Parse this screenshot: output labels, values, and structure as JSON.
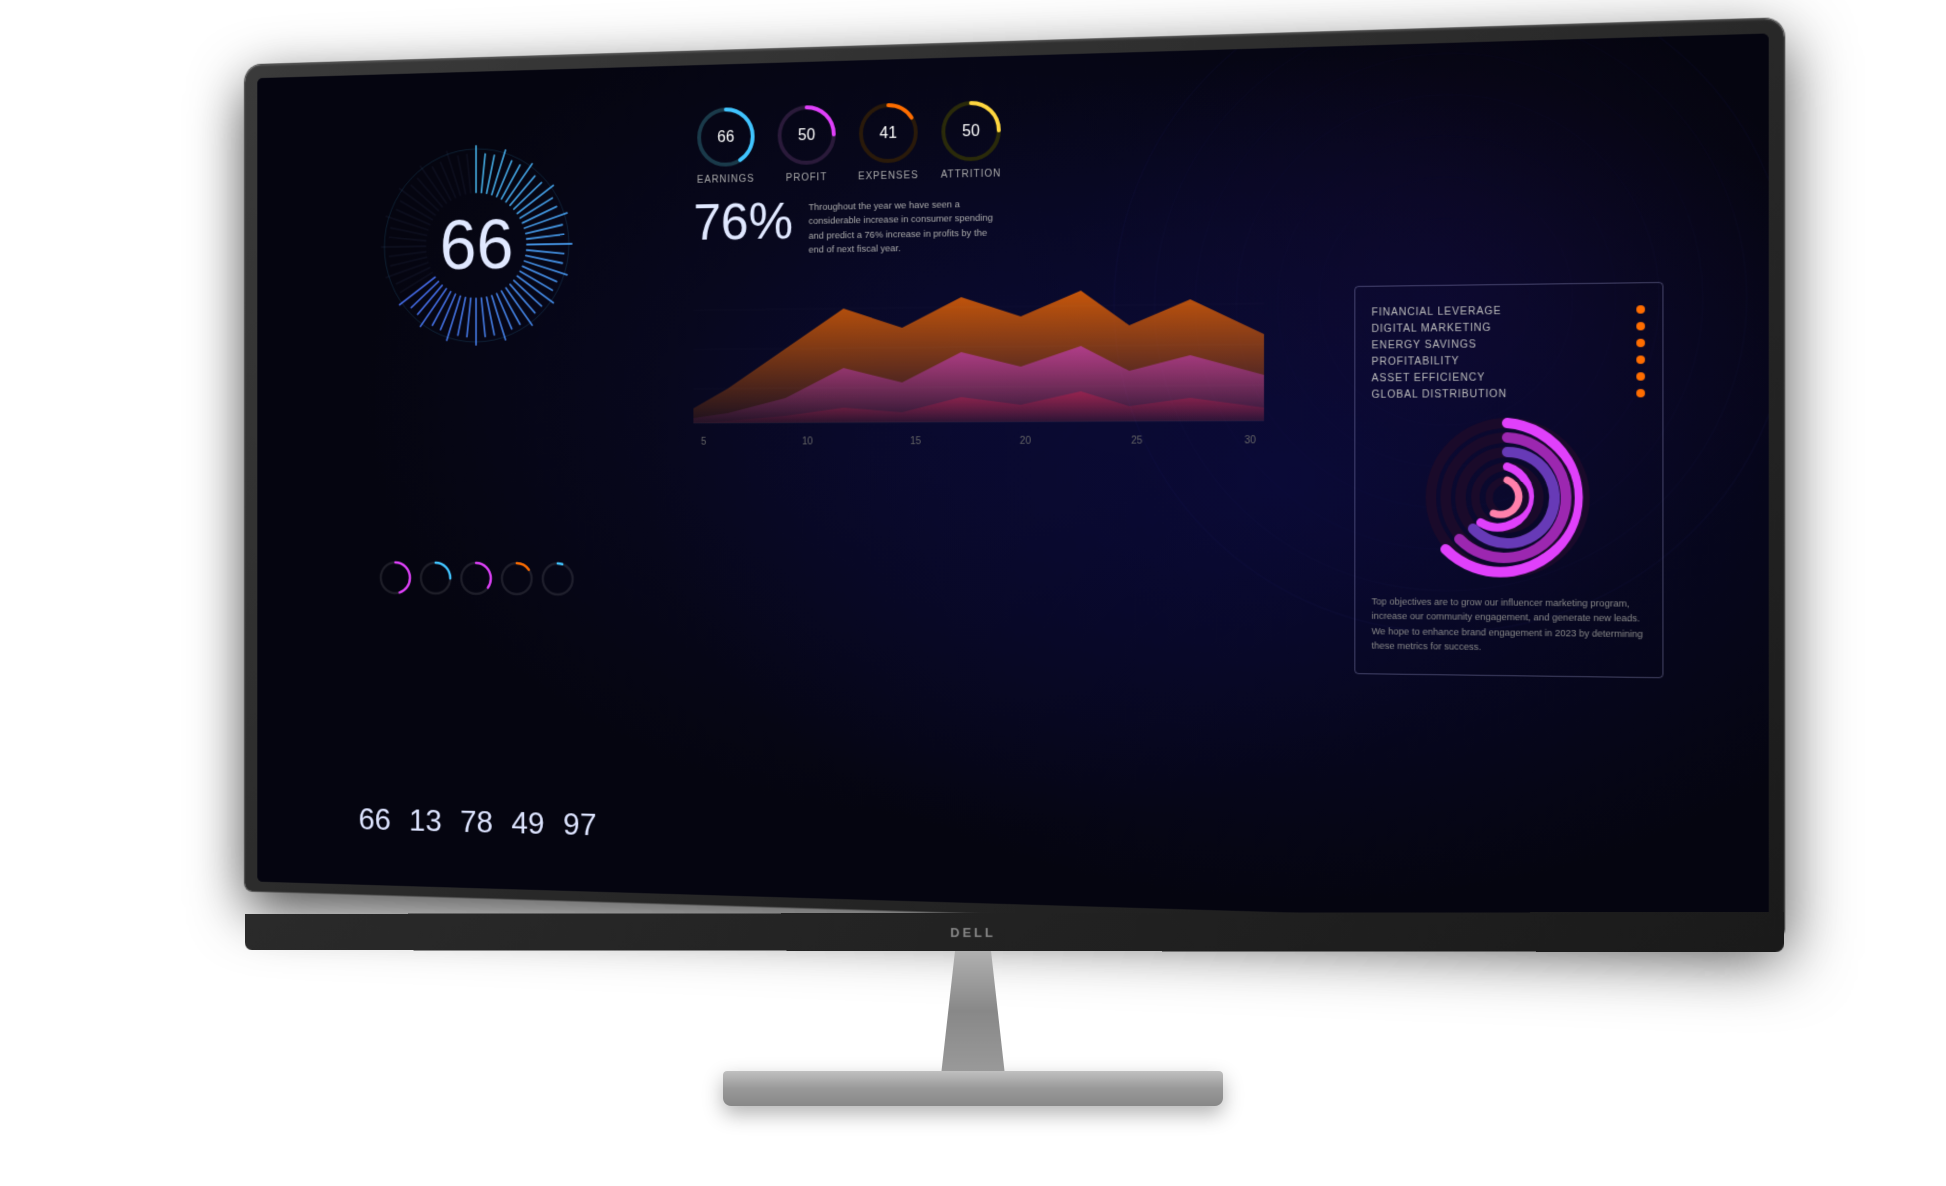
{
  "monitor": {
    "brand": "DELL",
    "stand_alt": "Dell monitor stand"
  },
  "dashboard": {
    "left": {
      "main_value": "66",
      "small_circles": [
        {
          "color": "#e040fb"
        },
        {
          "color": "#40c4ff"
        },
        {
          "color": "#e040fb"
        },
        {
          "color": "#ff6d00"
        },
        {
          "color": "#40c4ff"
        }
      ],
      "bottom_values": [
        "66",
        "13",
        "78",
        "49",
        "97"
      ]
    },
    "middle": {
      "kpis": [
        {
          "value": "66",
          "label": "EARNINGS",
          "color": "#40c4ff",
          "track": "#1a3a4a",
          "pct": 0.66
        },
        {
          "value": "50",
          "label": "PROFIT",
          "color": "#e040fb",
          "track": "#2a1a3a",
          "pct": 0.5
        },
        {
          "value": "41",
          "label": "EXPENSES",
          "color": "#ff6d00",
          "track": "#2a1a0a",
          "pct": 0.41
        },
        {
          "value": "50",
          "label": "ATTRITION",
          "color": "#ffd740",
          "track": "#2a2a0a",
          "pct": 0.5
        }
      ],
      "percentage": "76%",
      "description": "Throughout the year we have seen a considerable increase in consumer spending and predict a 76% increase in profits by the end of next fiscal year.",
      "chart": {
        "x_labels": [
          "5",
          "10",
          "15",
          "20",
          "25",
          "30"
        ]
      }
    },
    "right": {
      "legend": [
        {
          "label": "FINANCIAL LEVERAGE",
          "color": "#ff6d00"
        },
        {
          "label": "DIGITAL MARKETING",
          "color": "#ff6d00"
        },
        {
          "label": "ENERGY SAVINGS",
          "color": "#ff6d00"
        },
        {
          "label": "PROFITABILITY",
          "color": "#ff6d00"
        },
        {
          "label": "ASSET EFFICIENCY",
          "color": "#ff6d00"
        },
        {
          "label": "GLOBAL DISTRIBUTION",
          "color": "#ff6d00"
        }
      ],
      "description": "Top objectives are to grow our influencer marketing program, increase our community engagement, and generate new leads. We hope to enhance brand engagement in 2023 by determining these metrics for success.",
      "rings": [
        {
          "color": "#e040fb",
          "r": 75,
          "pct": 0.7
        },
        {
          "color": "#9c27b0",
          "r": 62,
          "pct": 0.6
        },
        {
          "color": "#673ab7",
          "r": 49,
          "pct": 0.8
        },
        {
          "color": "#e040fb",
          "r": 36,
          "pct": 0.5
        },
        {
          "color": "#ff4081",
          "r": 23,
          "pct": 0.65
        }
      ]
    }
  }
}
